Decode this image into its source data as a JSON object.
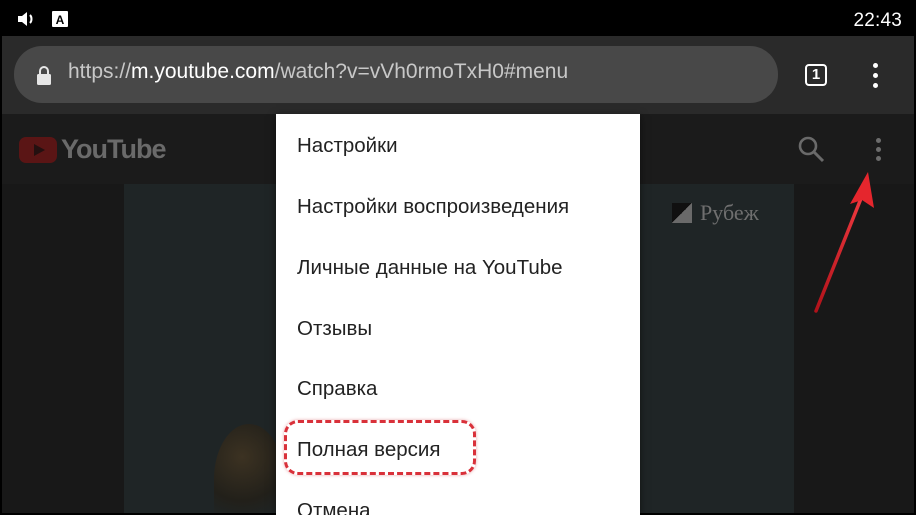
{
  "status_bar": {
    "time": "22:43",
    "icons": [
      "volume-icon",
      "keyboard-a-icon"
    ]
  },
  "browser": {
    "url_prefix": "https://",
    "url_host": "m.youtube.com",
    "url_path": "/watch?v=vVh0rmoTxH0#menu",
    "tab_count": "1",
    "icons": [
      "lock-icon",
      "tab-switcher-icon",
      "more-vert-icon"
    ]
  },
  "youtube_header": {
    "logo_text": "YouTube",
    "icons": [
      "youtube-play-icon",
      "search-icon",
      "more-vert-icon"
    ]
  },
  "video": {
    "channel_logo_text": "Рубеж"
  },
  "menu": {
    "items": [
      {
        "label": "Настройки"
      },
      {
        "label": "Настройки воспроизведения"
      },
      {
        "label": "Личные данные на YouTube"
      },
      {
        "label": "Отзывы"
      },
      {
        "label": "Справка"
      },
      {
        "label": "Полная версия"
      },
      {
        "label": "Отмена"
      }
    ]
  },
  "colors": {
    "highlight": "#d9313a",
    "omnibox": "#484848",
    "chrome_bar": "#2a2a2a"
  }
}
